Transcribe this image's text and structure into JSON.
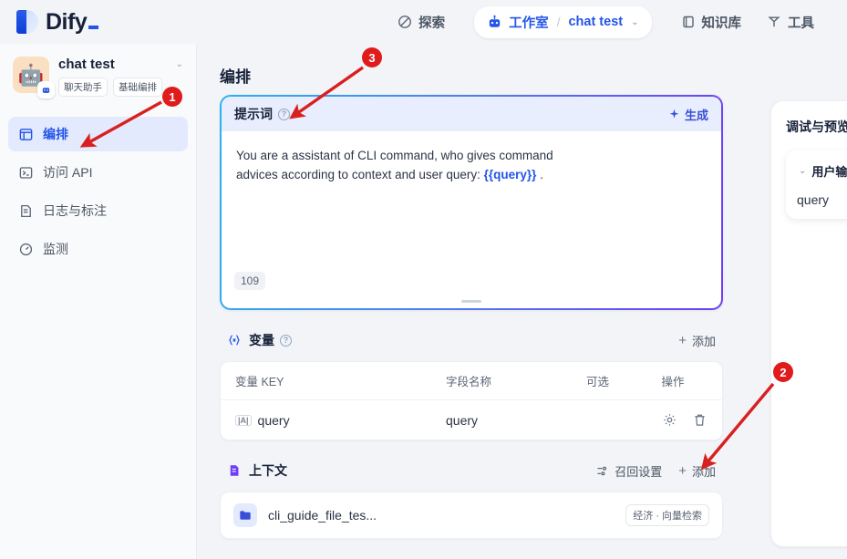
{
  "header": {
    "brand": "Dify",
    "nav": [
      {
        "label": "探索",
        "icon": "compass-icon"
      },
      {
        "label": "知识库",
        "icon": "book-icon"
      },
      {
        "label": "工具",
        "icon": "tool-icon"
      }
    ],
    "pill": {
      "workspace": "工作室",
      "separator": "/",
      "app_name": "chat test",
      "icon": "robot-icon",
      "chevron": "⌄"
    }
  },
  "sidebar": {
    "app_name": "chat test",
    "app_avatar": "🤖",
    "tags": [
      "聊天助手",
      "基础编排"
    ],
    "items": [
      {
        "label": "编排",
        "icon": "layout-icon",
        "active": true
      },
      {
        "label": "访问 API",
        "icon": "terminal-icon",
        "active": false
      },
      {
        "label": "日志与标注",
        "icon": "document-icon",
        "active": false
      },
      {
        "label": "监测",
        "icon": "gauge-icon",
        "active": false
      }
    ]
  },
  "main": {
    "page_title": "编排",
    "prompt": {
      "title": "提示词",
      "help": "?",
      "generate_label": "生成",
      "text_line1": "You are a assistant of CLI command, who gives command",
      "text_line2_pre": "advices according to context and user query: ",
      "text_variable": "{{query}}",
      "text_line2_post": " .",
      "char_count": "109"
    },
    "variables": {
      "title": "变量",
      "help": "?",
      "add_label": "添加",
      "columns": [
        "变量 KEY",
        "字段名称",
        "可选",
        "操作"
      ],
      "rows": [
        {
          "key": "query",
          "type_badge": "|A|",
          "field_name": "query",
          "optional": true
        }
      ]
    },
    "context": {
      "title": "上下文",
      "recall_label": "召回设置",
      "add_label": "添加",
      "items": [
        {
          "name": "cli_guide_file_tes...",
          "badge": "经济 · 向量检索"
        }
      ]
    }
  },
  "right_panel": {
    "title": "调试与预览",
    "user_input": {
      "title": "用户输入",
      "chevron": "⌄",
      "field_label": "query"
    }
  },
  "annotations": [
    {
      "number": "1"
    },
    {
      "number": "2"
    },
    {
      "number": "3"
    }
  ],
  "colors": {
    "accent": "#2355e8",
    "annotation": "#e01b1b",
    "toggle_on": "#155eef"
  }
}
